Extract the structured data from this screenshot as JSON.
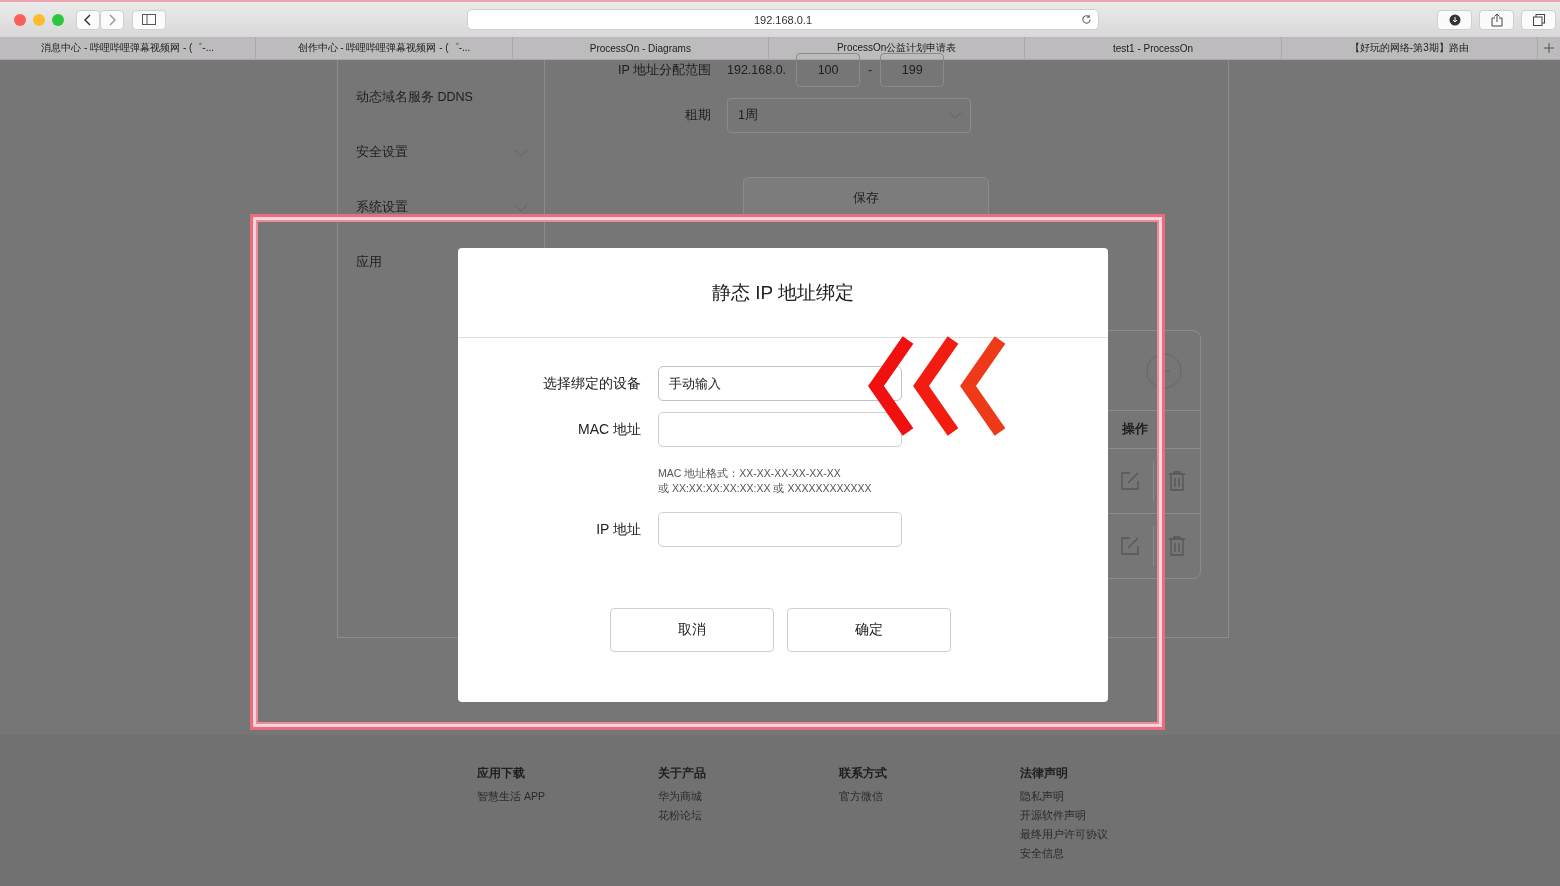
{
  "browser": {
    "address": "192.168.0.1",
    "tabs": [
      {
        "title": "消息中心 - 哔哩哔哩弹幕视频网 - (゜-..."
      },
      {
        "title": "创作中心 - 哔哩哔哩弹幕视频网 - (゜-..."
      },
      {
        "title": "ProcessOn - Diagrams"
      },
      {
        "title": "ProcessOn公益计划申请表"
      },
      {
        "title": "test1 - ProcessOn"
      },
      {
        "title": "【好玩的网络-第3期】路由"
      }
    ]
  },
  "sidebar": {
    "items": [
      {
        "label": "动态域名服务 DDNS",
        "kind": "link"
      },
      {
        "label": "安全设置",
        "kind": "group"
      },
      {
        "label": "系统设置",
        "kind": "group"
      },
      {
        "label": "应用",
        "kind": "link"
      }
    ]
  },
  "dhcp_form": {
    "range_label": "IP 地址分配范围",
    "range_prefix": "192.168.0.",
    "range_start": "100",
    "range_separator": "-",
    "range_end": "199",
    "lease_label": "租期",
    "lease_value": "1周",
    "save_button": "保存"
  },
  "binding_table": {
    "action_header": "操作",
    "rows": [
      {
        "kind": "entry"
      },
      {
        "kind": "entry"
      }
    ]
  },
  "dialog": {
    "title": "静态 IP 地址绑定",
    "fields": [
      {
        "label": "选择绑定的设备",
        "kind": "select",
        "value": "手动输入"
      },
      {
        "label": "MAC 地址",
        "kind": "input",
        "hint": [
          "MAC 地址格式：XX-XX-XX-XX-XX-XX",
          "或 XX:XX:XX:XX:XX:XX 或 XXXXXXXXXXXX"
        ]
      },
      {
        "label": "IP 地址",
        "kind": "input"
      }
    ],
    "buttons": [
      "取消",
      "确定"
    ]
  },
  "footer": {
    "columns": [
      {
        "title": "应用下载",
        "links": [
          "智慧生活 APP"
        ]
      },
      {
        "title": "关于产品",
        "links": [
          "华为商城",
          "花粉论坛"
        ]
      },
      {
        "title": "联系方式",
        "links": [
          "官方微信"
        ]
      },
      {
        "title": "法律声明",
        "links": [
          "隐私声明",
          "开源软件声明",
          "最终用户许可协议",
          "安全信息"
        ]
      }
    ]
  }
}
